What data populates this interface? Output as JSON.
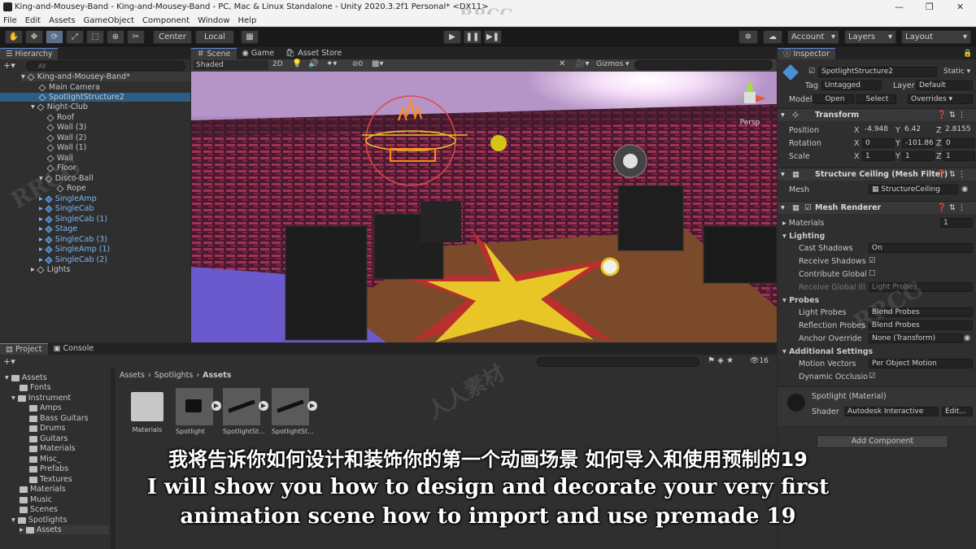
{
  "window": {
    "title": "King-and-Mousey-Band - King-and-Mousey-Band - PC, Mac & Linux Standalone - Unity 2020.3.2f1 Personal* <DX11>",
    "minimize": "—",
    "maximize": "❐",
    "close": "✕"
  },
  "watermark": {
    "top": "RRCG",
    "mid1": "RRCG",
    "mid2": "人人素材",
    "mid3": "RRCG"
  },
  "menu": [
    "File",
    "Edit",
    "Assets",
    "GameObject",
    "Component",
    "Window",
    "Help"
  ],
  "toolbar": {
    "center": "Center",
    "local": "Local",
    "account": "Account",
    "layers": "Layers",
    "layout": "Layout"
  },
  "hierarchy": {
    "tab": "Hierarchy",
    "search_placeholder": "All",
    "scene_root": "King-and-Mousey-Band*",
    "items": [
      {
        "label": "Main Camera"
      },
      {
        "label": "SpotlightStructure2"
      },
      {
        "label": "Night-Club"
      },
      {
        "label": "Roof"
      },
      {
        "label": "Wall (3)"
      },
      {
        "label": "Wall (2)"
      },
      {
        "label": "Wall (1)"
      },
      {
        "label": "Wall"
      },
      {
        "label": "Floor"
      },
      {
        "label": "Disco-Ball"
      },
      {
        "label": "Rope"
      },
      {
        "label": "SingleAmp"
      },
      {
        "label": "SingleCab"
      },
      {
        "label": "SingleCab (1)"
      },
      {
        "label": "Stage"
      },
      {
        "label": "SingleCab (3)"
      },
      {
        "label": "SingleAmp (1)"
      },
      {
        "label": "SingleCab (2)"
      },
      {
        "label": "Lights"
      }
    ]
  },
  "scene": {
    "tabs": [
      "Scene",
      "Game",
      "Asset Store"
    ],
    "shading": "Shaded",
    "mode2d": "2D",
    "gizmos": "Gizmos",
    "persp": "Persp",
    "fx_count": "0"
  },
  "project": {
    "tabs": [
      "Project",
      "Console"
    ],
    "tree": [
      {
        "label": "Assets"
      },
      {
        "label": "Fonts"
      },
      {
        "label": "Instrument"
      },
      {
        "label": "Amps"
      },
      {
        "label": "Bass Guitars"
      },
      {
        "label": "Drums"
      },
      {
        "label": "Guitars"
      },
      {
        "label": "Materials"
      },
      {
        "label": "Misc_"
      },
      {
        "label": "Prefabs"
      },
      {
        "label": "Textures"
      },
      {
        "label": "Materials"
      },
      {
        "label": "Music"
      },
      {
        "label": "Scenes"
      },
      {
        "label": "Spotlights"
      },
      {
        "label": "Assets"
      }
    ],
    "breadcrumb": [
      "Assets",
      "Spotlights",
      "Assets"
    ],
    "count": "16",
    "assets": [
      "Materials",
      "Spotlight",
      "SpotlightSt...",
      "SpotlightSt..."
    ]
  },
  "inspector": {
    "tab": "Inspector",
    "object_name": "SpotlightStructure2",
    "static": "Static",
    "tag_label": "Tag",
    "tag": "Untagged",
    "layer_label": "Layer",
    "layer": "Default",
    "model_label": "Model",
    "open": "Open",
    "select": "Select",
    "overrides": "Overrides",
    "transform": {
      "title": "Transform",
      "position_label": "Position",
      "rotation_label": "Rotation",
      "scale_label": "Scale",
      "position": {
        "x": "-4.948",
        "y": "6.42",
        "z": "2.8155"
      },
      "rotation": {
        "x": "0",
        "y": "-101.86",
        "z": "0"
      },
      "scale": {
        "x": "1",
        "y": "1",
        "z": "1"
      }
    },
    "mesh_filter": {
      "title": "Structure Ceiling (Mesh Filter)",
      "mesh_label": "Mesh",
      "mesh": "StructureCeiling"
    },
    "mesh_renderer": {
      "title": "Mesh Renderer",
      "materials_label": "Materials",
      "materials_count": "1",
      "lighting": "Lighting",
      "cast_shadows_label": "Cast Shadows",
      "cast_shadows": "On",
      "receive_shadows_label": "Receive Shadows",
      "contribute_gi_label": "Contribute Global",
      "receive_gi_label": "Receive Global Ill",
      "receive_gi": "Light Probes",
      "probes": "Probes",
      "light_probes_label": "Light Probes",
      "light_probes": "Blend Probes",
      "reflection_probes_label": "Reflection Probes",
      "reflection_probes": "Blend Probes",
      "anchor_override_label": "Anchor Override",
      "anchor_override": "None (Transform)",
      "additional": "Additional Settings",
      "motion_vectors_label": "Motion Vectors",
      "motion_vectors": "Per Object Motion",
      "dynamic_occlusion_label": "Dynamic Occlusio"
    },
    "material": {
      "title": "Spotlight (Material)",
      "shader_label": "Shader",
      "shader": "Autodesk Interactive",
      "edit": "Edit..."
    },
    "add_component": "Add Component"
  },
  "subtitles": {
    "cn": "我将告诉你如何设计和装饰你的第一个动画场景 如何导入和使用预制的19",
    "en1": "I will show you how to design and decorate your very first",
    "en2": "animation scene how to import and use premade 19"
  },
  "colors": {
    "selection": "#2c5d87",
    "prefab_blue": "#7fb4f0",
    "floor_yellow": "#e8c628",
    "floor_red": "#b8302e"
  }
}
